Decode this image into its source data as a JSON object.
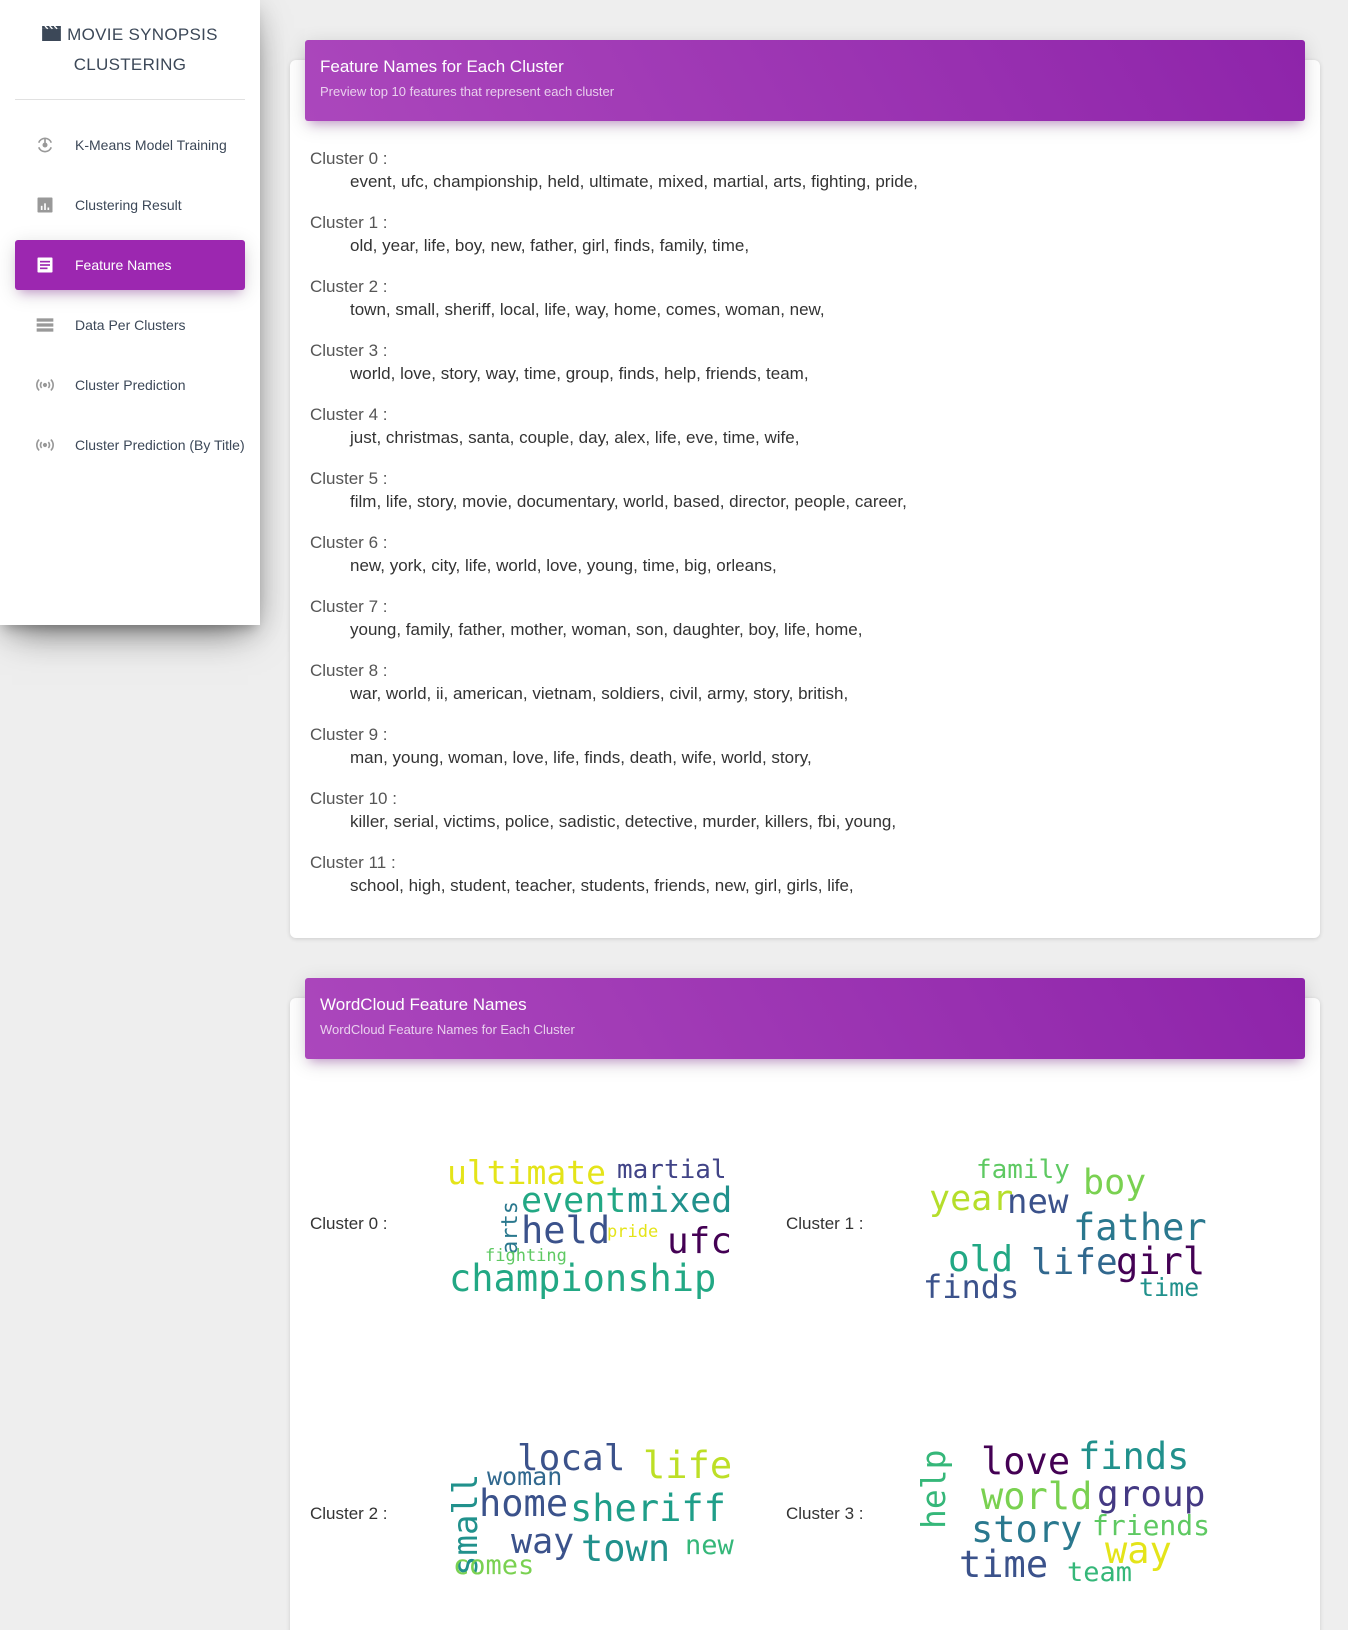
{
  "sidebar": {
    "brand_line1": "MOVIE SYNOPSIS",
    "brand_line2": "CLUSTERING",
    "items": [
      {
        "label": "K-Means Model Training",
        "icon": "training-icon",
        "active": false
      },
      {
        "label": "Clustering Result",
        "icon": "bar-chart-icon",
        "active": false
      },
      {
        "label": "Feature Names",
        "icon": "article-icon",
        "active": true
      },
      {
        "label": "Data Per Clusters",
        "icon": "storage-icon",
        "active": false
      },
      {
        "label": "Cluster Prediction",
        "icon": "broadcast-icon",
        "active": false
      },
      {
        "label": "Cluster Prediction (By Title)",
        "icon": "broadcast-icon",
        "active": false
      }
    ]
  },
  "features_card": {
    "title": "Feature Names for Each Cluster",
    "subtitle": "Preview top 10 features that represent each cluster",
    "clusters": [
      {
        "label": "Cluster 0 :",
        "words": "event, ufc, championship, held, ultimate, mixed, martial, arts, fighting, pride,"
      },
      {
        "label": "Cluster 1 :",
        "words": "old, year, life, boy, new, father, girl, finds, family, time,"
      },
      {
        "label": "Cluster 2 :",
        "words": "town, small, sheriff, local, life, way, home, comes, woman, new,"
      },
      {
        "label": "Cluster 3 :",
        "words": "world, love, story, way, time, group, finds, help, friends, team,"
      },
      {
        "label": "Cluster 4 :",
        "words": "just, christmas, santa, couple, day, alex, life, eve, time, wife,"
      },
      {
        "label": "Cluster 5 :",
        "words": "film, life, story, movie, documentary, world, based, director, people, career,"
      },
      {
        "label": "Cluster 6 :",
        "words": "new, york, city, life, world, love, young, time, big, orleans,"
      },
      {
        "label": "Cluster 7 :",
        "words": "young, family, father, mother, woman, son, daughter, boy, life, home,"
      },
      {
        "label": "Cluster 8 :",
        "words": "war, world, ii, american, vietnam, soldiers, civil, army, story, british,"
      },
      {
        "label": "Cluster 9 :",
        "words": "man, young, woman, love, life, finds, death, wife, world, story,"
      },
      {
        "label": "Cluster 10 :",
        "words": "killer, serial, victims, police, sadistic, detective, murder, killers, fbi, young,"
      },
      {
        "label": "Cluster 11 :",
        "words": "school, high, student, teacher, students, friends, new, girl, girls, life,"
      }
    ]
  },
  "wordcloud_card": {
    "title": "WordCloud Feature Names",
    "subtitle": "WordCloud Feature Names for Each Cluster",
    "clouds": [
      {
        "label": "Cluster 0 :",
        "words": [
          "ultimate",
          "martial",
          "arts",
          "event",
          "mixed",
          "held",
          "pride",
          "ufc",
          "fighting",
          "championship"
        ]
      },
      {
        "label": "Cluster 1 :",
        "words": [
          "family",
          "boy",
          "year",
          "new",
          "father",
          "old",
          "life",
          "girl",
          "finds",
          "time"
        ]
      },
      {
        "label": "Cluster 2 :",
        "words": [
          "local",
          "life",
          "woman",
          "small",
          "home",
          "sheriff",
          "way",
          "town",
          "new",
          "comes"
        ]
      },
      {
        "label": "Cluster 3 :",
        "words": [
          "help",
          "love",
          "finds",
          "world",
          "group",
          "story",
          "friends",
          "way",
          "time",
          "team"
        ]
      }
    ]
  },
  "colors": {
    "accent": "#9c27b0",
    "viridis_yellow": "#e4e419",
    "viridis_green": "#5ec962",
    "viridis_teal": "#21918c",
    "viridis_blue": "#3b528b",
    "viridis_purple": "#440154"
  }
}
